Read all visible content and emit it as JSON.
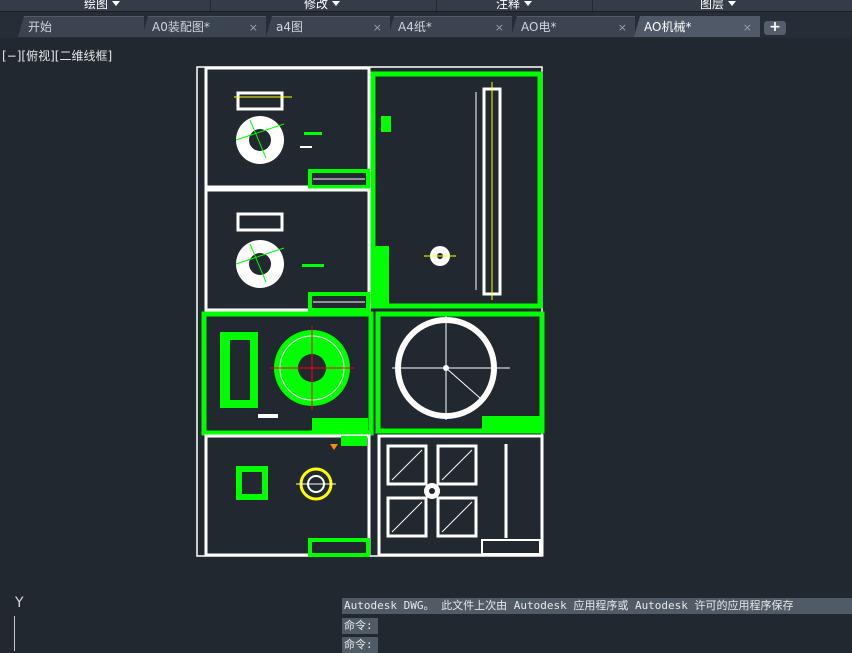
{
  "ribbon": {
    "panels": [
      "绘图",
      "修改",
      "注释",
      "图层"
    ]
  },
  "tabs": [
    {
      "label": "开始",
      "closable": false,
      "active": false
    },
    {
      "label": "A0装配图*",
      "closable": true,
      "active": false
    },
    {
      "label": "a4图",
      "closable": true,
      "active": false
    },
    {
      "label": "A4纸*",
      "closable": true,
      "active": false
    },
    {
      "label": "AO电*",
      "closable": true,
      "active": false
    },
    {
      "label": "AO机械*",
      "closable": true,
      "active": true
    }
  ],
  "new_tab_label": "+",
  "close_glyph": "×",
  "viewport": {
    "label": "[−][俯视][二维线框]"
  },
  "ucs": {
    "y_axis_label": "Y"
  },
  "command_line": {
    "history": "Autodesk DWG。  此文件上次由 Autodesk 应用程序或 Autodesk 许可的应用程序保存",
    "prompt1": "命令:",
    "prompt2": "命令:"
  },
  "colors": {
    "background": "#212830",
    "selection": "#00ff00",
    "geometry": "#ffffff",
    "accent_yellow": "#ffff00",
    "accent_red": "#ff0000"
  }
}
